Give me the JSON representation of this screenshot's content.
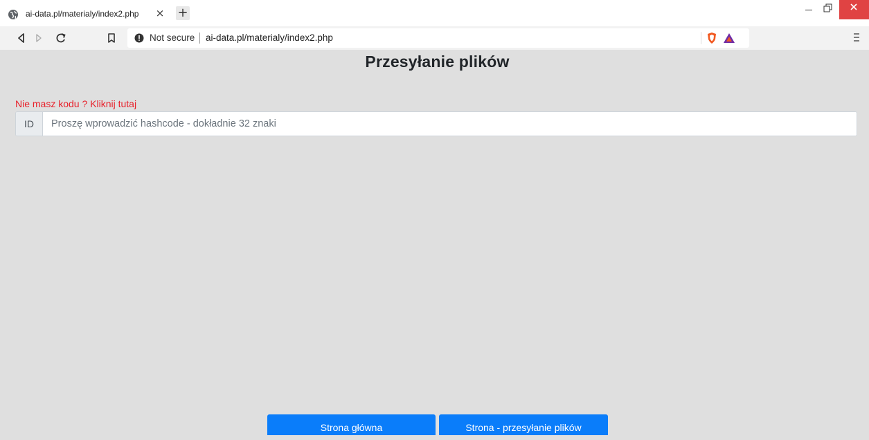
{
  "browser": {
    "tab_title": "ai-data.pl/materialy/index2.php",
    "tab_close": "×",
    "new_tab": "+",
    "security_label": "Not secure",
    "url": "ai-data.pl/materialy/index2.php"
  },
  "page": {
    "title": "Przesyłanie plików",
    "no_code_link": "Nie masz kodu ? Kliknij tutaj",
    "id_addon": "ID",
    "hash_placeholder": "Proszę wprowadzić hashcode - dokładnie 32 znaki",
    "hash_value": ""
  },
  "footer": {
    "home_button": "Strona główna",
    "upload_button": "Strona - przesyłanie plików"
  },
  "colors": {
    "link_red": "#e8202a",
    "button_blue": "#0a7dfa",
    "page_bg": "#dfdfdf"
  }
}
